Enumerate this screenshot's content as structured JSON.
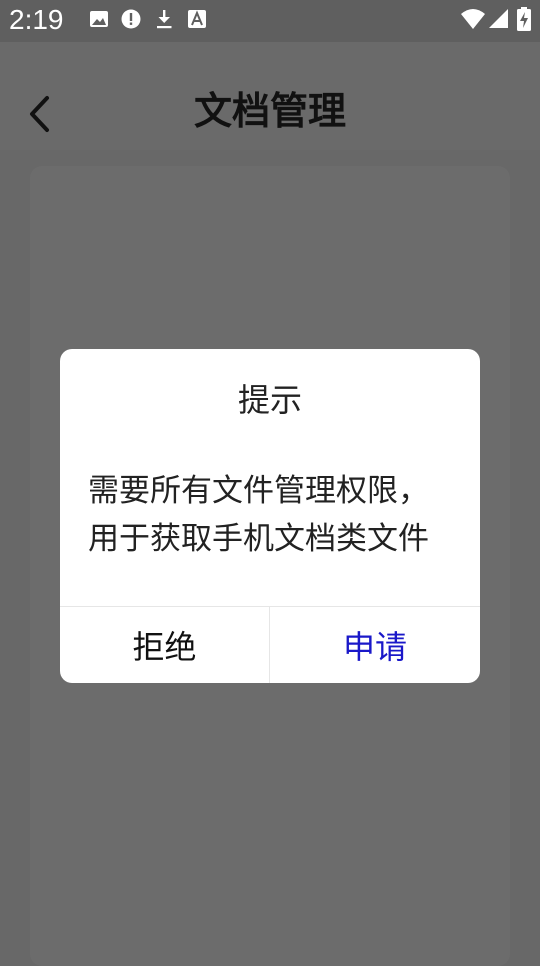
{
  "status_bar": {
    "time": "2:19",
    "left_icons": [
      "image-icon",
      "alert-icon",
      "download-icon",
      "text-a-icon"
    ],
    "right_icons": [
      "wifi-icon",
      "signal-icon",
      "battery-charging-icon"
    ]
  },
  "header": {
    "back_icon": "chevron-left-icon",
    "title": "文档管理"
  },
  "dialog": {
    "title": "提示",
    "message_lines": [
      "需要所有文件管理权限，",
      "用于获取手机文档类文件"
    ],
    "reject_label": "拒绝",
    "apply_label": "申请",
    "apply_color": "#1a18c9"
  },
  "colors": {
    "scrim": "#686868",
    "dialog_bg": "#ffffff"
  }
}
